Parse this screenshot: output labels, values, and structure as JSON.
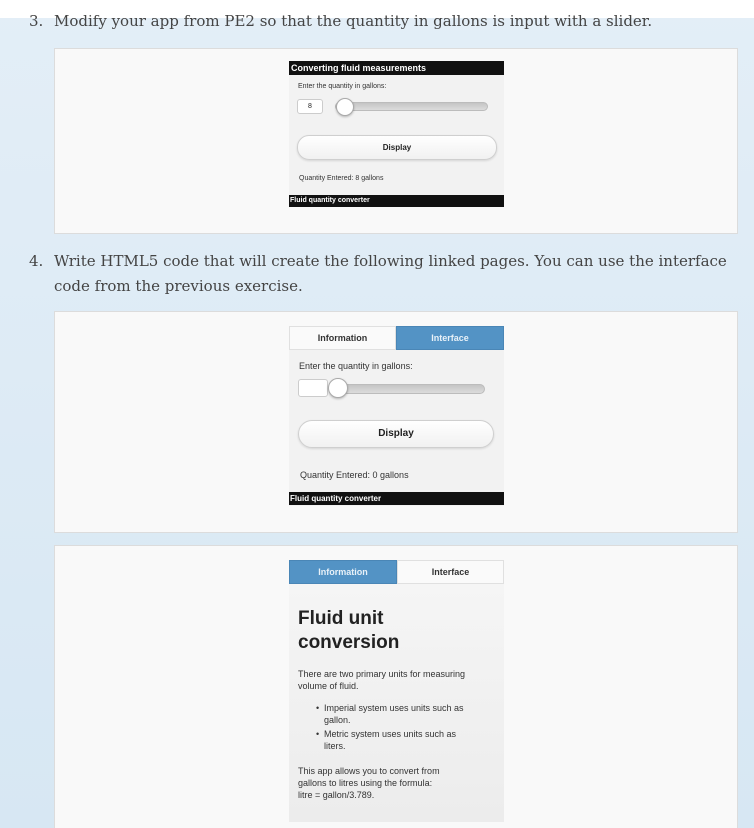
{
  "questions": [
    {
      "number": "3.",
      "line1": "Modify your app from PE2 so that the quantity in gallons is input with a slider.",
      "screenshot": {
        "header": "Converting fluid measurements",
        "prompt_label": "Enter the quantity in gallons:",
        "quantity_value": "8",
        "slider_level": 0.04,
        "button_label": "Display",
        "result_text": "Quantity Entered: 8 gallons",
        "footer": "Fluid quantity converter"
      }
    },
    {
      "number": "4.",
      "line1": "Write HTML5 code that will create the following linked pages. You can use the interface",
      "line2": "code from the previous exercise.",
      "interface_screenshot": {
        "tabs": [
          {
            "label": "Information",
            "active": false
          },
          {
            "label": "Interface",
            "active": true
          }
        ],
        "prompt_label": "Enter the quantity in gallons:",
        "quantity_value": "",
        "slider_level": 0.0,
        "button_label": "Display",
        "result_text": "Quantity Entered: 0 gallons",
        "footer": "Fluid quantity converter"
      },
      "information_screenshot": {
        "tabs": [
          {
            "label": "Information",
            "active": true
          },
          {
            "label": "Interface",
            "active": false
          }
        ],
        "heading_line1": "Fluid unit",
        "heading_line2": "conversion",
        "intro_line1": "There are two primary units for measuring",
        "intro_line2": "volume of fluid.",
        "bullets": [
          {
            "line1": "Imperial system uses units such as",
            "line2": "gallon."
          },
          {
            "line1": "Metric system uses units such as",
            "line2": "liters."
          }
        ],
        "outro_line1": "This app allows you to convert from",
        "outro_line2": "gallons to litres using the formula:",
        "outro_line3": "litre = gallon/3.789."
      }
    }
  ],
  "colors": {
    "active_tab": "#5393c5",
    "header_bar": "#111111",
    "page_background": "#dde9f4"
  }
}
